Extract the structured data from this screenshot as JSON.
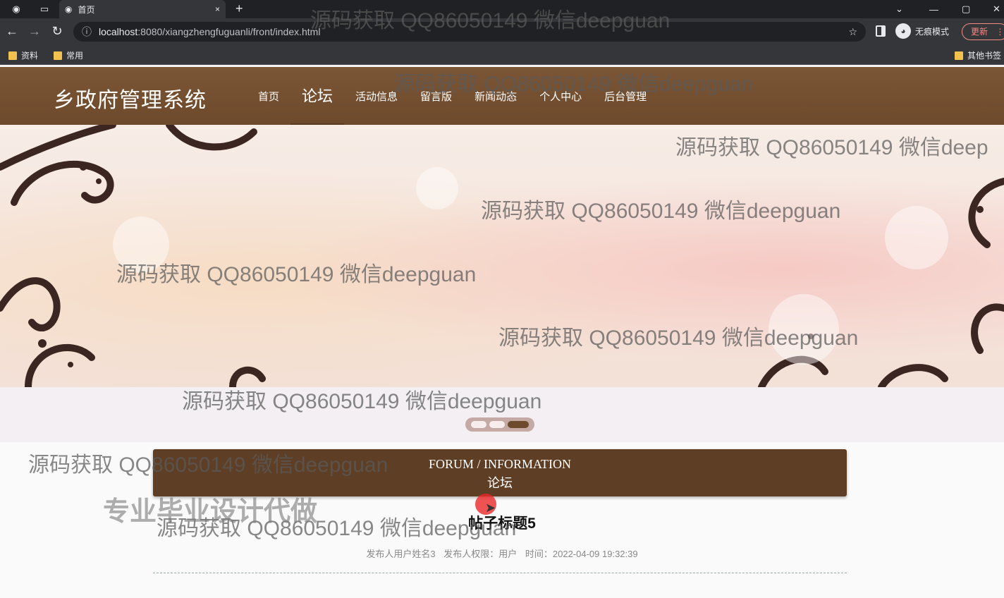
{
  "browser": {
    "tab_title": "首页",
    "new_tab": "+",
    "close": "×",
    "back": "←",
    "forward": "→",
    "reload": "↻",
    "info": "ⓘ",
    "url_host": "localhost",
    "url_rest": ":8080/xiangzhengfuguanli/front/index.html",
    "star": "☆",
    "incognito_label": "无痕模式",
    "update_label": "更新",
    "menu_dots": "⋮",
    "bookmarks": [
      "资料",
      "常用"
    ],
    "other_bookmarks": "其他书签",
    "win_min": "—",
    "win_max": "▢",
    "win_close": "✕",
    "chevron": "⌄"
  },
  "site": {
    "title": "乡政府管理系统",
    "menu": [
      "首页",
      "论坛",
      "活动信息",
      "留言版",
      "新闻动态",
      "个人中心",
      "后台管理"
    ],
    "active_menu": 1
  },
  "carousel": {
    "slides": 3,
    "active": 3
  },
  "forum": {
    "heading_en": "FORUM / INFORMATION",
    "heading_zh": "论坛"
  },
  "post": {
    "title": "帖子标题5",
    "author": "发布人用户姓名3",
    "role": "发布人权限：用户",
    "time": "时间：2022-04-09 19:32:39"
  },
  "watermark": {
    "text": "源码获取 QQ86050149 微信deepguan",
    "text_cut": "源码获取 QQ86050149 微信deep",
    "bold_text": "专业毕业设计代做"
  }
}
